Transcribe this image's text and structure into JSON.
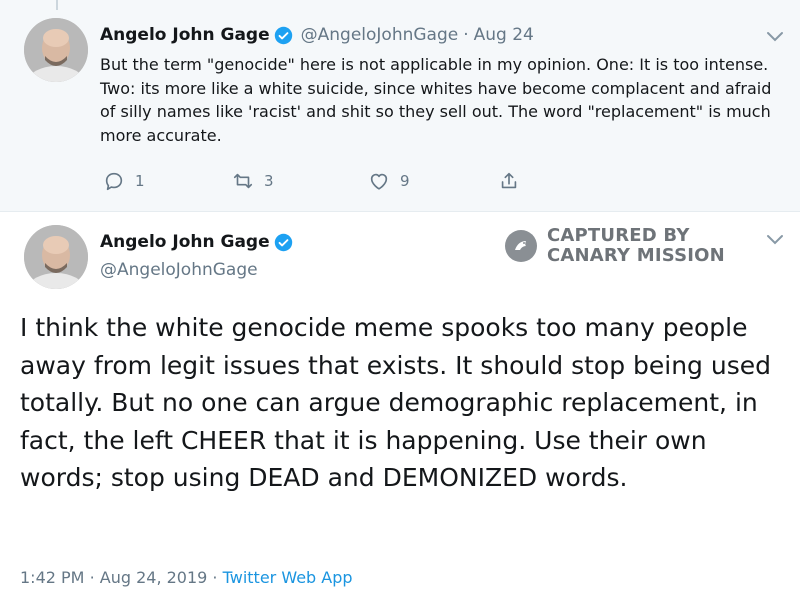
{
  "reply_tweet": {
    "author_name": "Angelo John Gage",
    "author_handle": "@AngeloJohnGage",
    "date": "Aug 24",
    "text": "But the term \"genocide\" here is not applicable in my opinion. One: It is too intense. Two: its more like a white suicide, since whites have become complacent and afraid of silly names like 'racist' and shit so they sell out. The word \"replacement\" is much more accurate.",
    "reply_count": "1",
    "retweet_count": "3",
    "like_count": "9"
  },
  "main_tweet": {
    "author_name": "Angelo John Gage",
    "author_handle": "@AngeloJohnGage",
    "text": "I think the white genocide meme spooks too many people away from legit issues that exists. It should stop being used totally. But no one can argue demographic replacement, in fact, the left CHEER that it is happening. Use their own words; stop using DEAD and DEMONIZED words.",
    "time": "1:42 PM",
    "date": "Aug 24, 2019",
    "source": "Twitter Web App"
  },
  "watermark": {
    "line1": "CAPTURED BY",
    "line2": "CANARY MISSION"
  },
  "separator": "·",
  "colors": {
    "verified": "#1da1f2",
    "link": "#1b95e0",
    "muted": "#657786",
    "reply_bg": "#f5f8fa"
  },
  "icons": [
    "reply-icon",
    "retweet-icon",
    "like-icon",
    "share-icon",
    "verified-badge-icon",
    "chevron-down-icon",
    "canary-bird-icon"
  ]
}
